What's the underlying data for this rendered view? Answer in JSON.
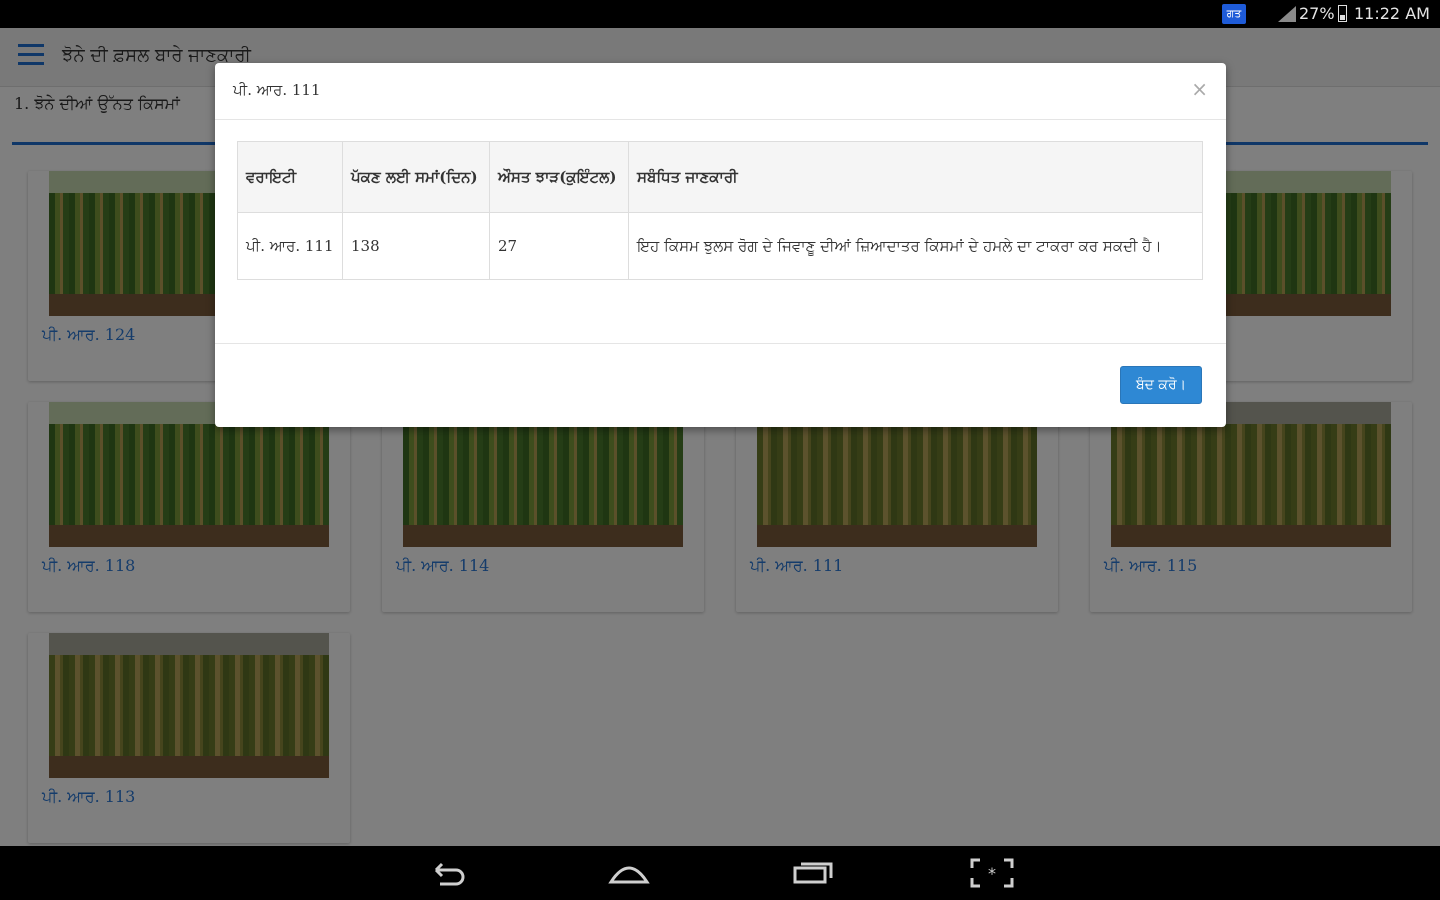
{
  "status_bar": {
    "badge": "ਗਤ",
    "battery_percent": "27%",
    "time": "11:22 AM"
  },
  "app": {
    "title": "ਝੋਨੇ ਦੀ ਫ਼ਸਲ ਬਾਰੇ ਜਾਣਕਾਰੀ",
    "section_title": "1. ਝੋਨੇ ਦੀਆਂ ਉੱਨਤ ਕਿਸਮਾਂ",
    "cards": [
      {
        "label": "ਪੀ. ਆਰ. 124"
      },
      {
        "label": "ਪੀ. ਆਰ. 118"
      },
      {
        "label": "ਪੀ. ਆਰ. 114"
      },
      {
        "label": "ਪੀ. ਆਰ. 111"
      },
      {
        "label": "ਪੀ. ਆਰ. 115"
      },
      {
        "label": "ਪੀ. ਆਰ. 113"
      }
    ]
  },
  "modal": {
    "title": "ਪੀ. ਆਰ. 111",
    "close_glyph": "×",
    "table": {
      "headers": [
        "ਵਰਾਇਟੀ",
        "ਪੱਕਣ ਲਈ ਸਮਾਂ(ਦਿਨ)",
        "ਔਸਤ ਝਾੜ(ਕੁਇੰਟਲ)",
        "ਸਬੰਧਿਤ ਜਾਣਕਾਰੀ"
      ],
      "rows": [
        [
          "ਪੀ. ਆਰ. 111",
          "138",
          "27",
          "ਇਹ ਕਿਸਮ ਝੁਲਸ ਰੋਗ ਦੇ ਜਿਵਾਣੂ ਦੀਆਂ ਜ਼ਿਆਦਾਤਰ ਕਿਸਮਾਂ ਦੇ ਹਮਲੇ ਦਾ ਟਾਕਰਾ ਕਰ ਸਕਦੀ ਹੈ।"
        ]
      ]
    },
    "close_button": "ਬੰਦ ਕਰੋ।"
  }
}
